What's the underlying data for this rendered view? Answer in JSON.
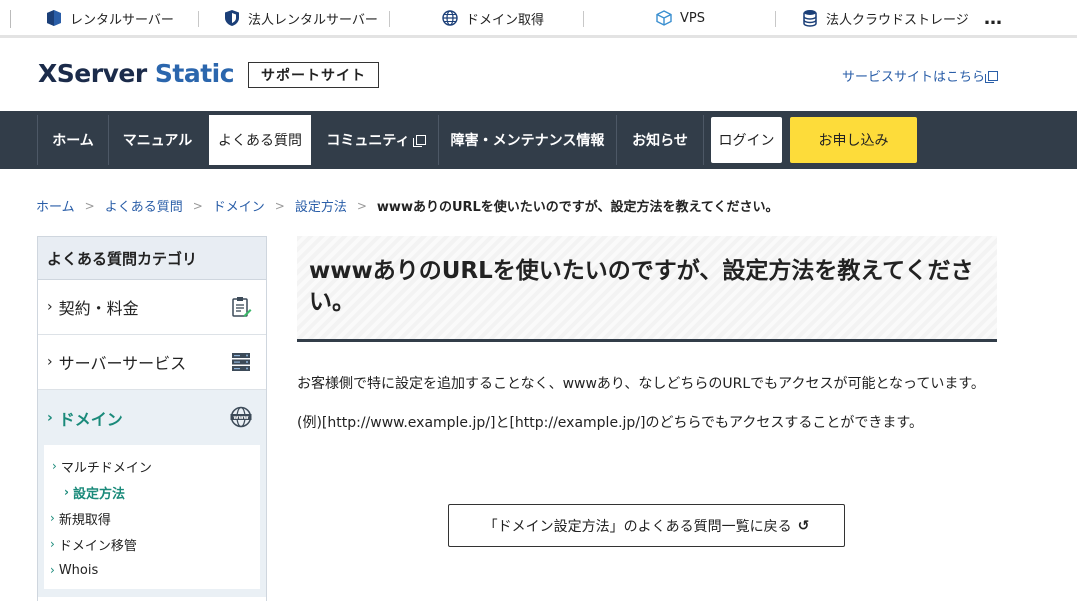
{
  "topbar": {
    "items": [
      {
        "label": "レンタルサーバー",
        "icon": "rental-server-icon"
      },
      {
        "label": "法人レンタルサーバー",
        "icon": "shield-icon"
      },
      {
        "label": "ドメイン取得",
        "icon": "globe-icon"
      },
      {
        "label": "VPS",
        "icon": "cube-icon"
      },
      {
        "label": "法人クラウドストレージ",
        "icon": "database-icon"
      }
    ],
    "more": "…"
  },
  "header": {
    "logo_x": "X",
    "logo_server": "Server",
    "logo_static": "Static",
    "support_badge": "サポートサイト",
    "service_link": "サービスサイトはこちら"
  },
  "nav": {
    "items": [
      "ホーム",
      "マニュアル",
      "よくある質問",
      "コミュニティ",
      "障害・メンテナンス情報",
      "お知らせ"
    ],
    "login": "ログイン",
    "apply": "お申し込み"
  },
  "breadcrumb": {
    "links": [
      "ホーム",
      "よくある質問",
      "ドメイン",
      "設定方法"
    ],
    "current": "wwwありのURLを使いたいのですが、設定方法を教えてください。"
  },
  "sidebar": {
    "heading": "よくある質問カテゴリ",
    "categories": [
      "契約・料金",
      "サーバーサービス",
      "ドメイン"
    ],
    "sub_links": [
      "マルチドメイン",
      "設定方法",
      "新規取得",
      "ドメイン移管",
      "Whois"
    ]
  },
  "main": {
    "title": "wwwありのURLを使いたいのですが、設定方法を教えてください。",
    "paragraph1": "お客様側で特に設定を追加することなく、wwwあり、なしどちらのURLでもアクセスが可能となっています。",
    "paragraph2": "(例)[http://www.example.jp/]と[http://example.jp/]のどちらでもアクセスすることができます。",
    "back_button": "「ドメイン設定方法」のよくある質問一覧に戻る"
  },
  "colors": {
    "nav_bg": "#323d49",
    "accent_yellow": "#fddc3a",
    "link_blue": "#2a5ea8",
    "active_green": "#1a8a7a"
  }
}
